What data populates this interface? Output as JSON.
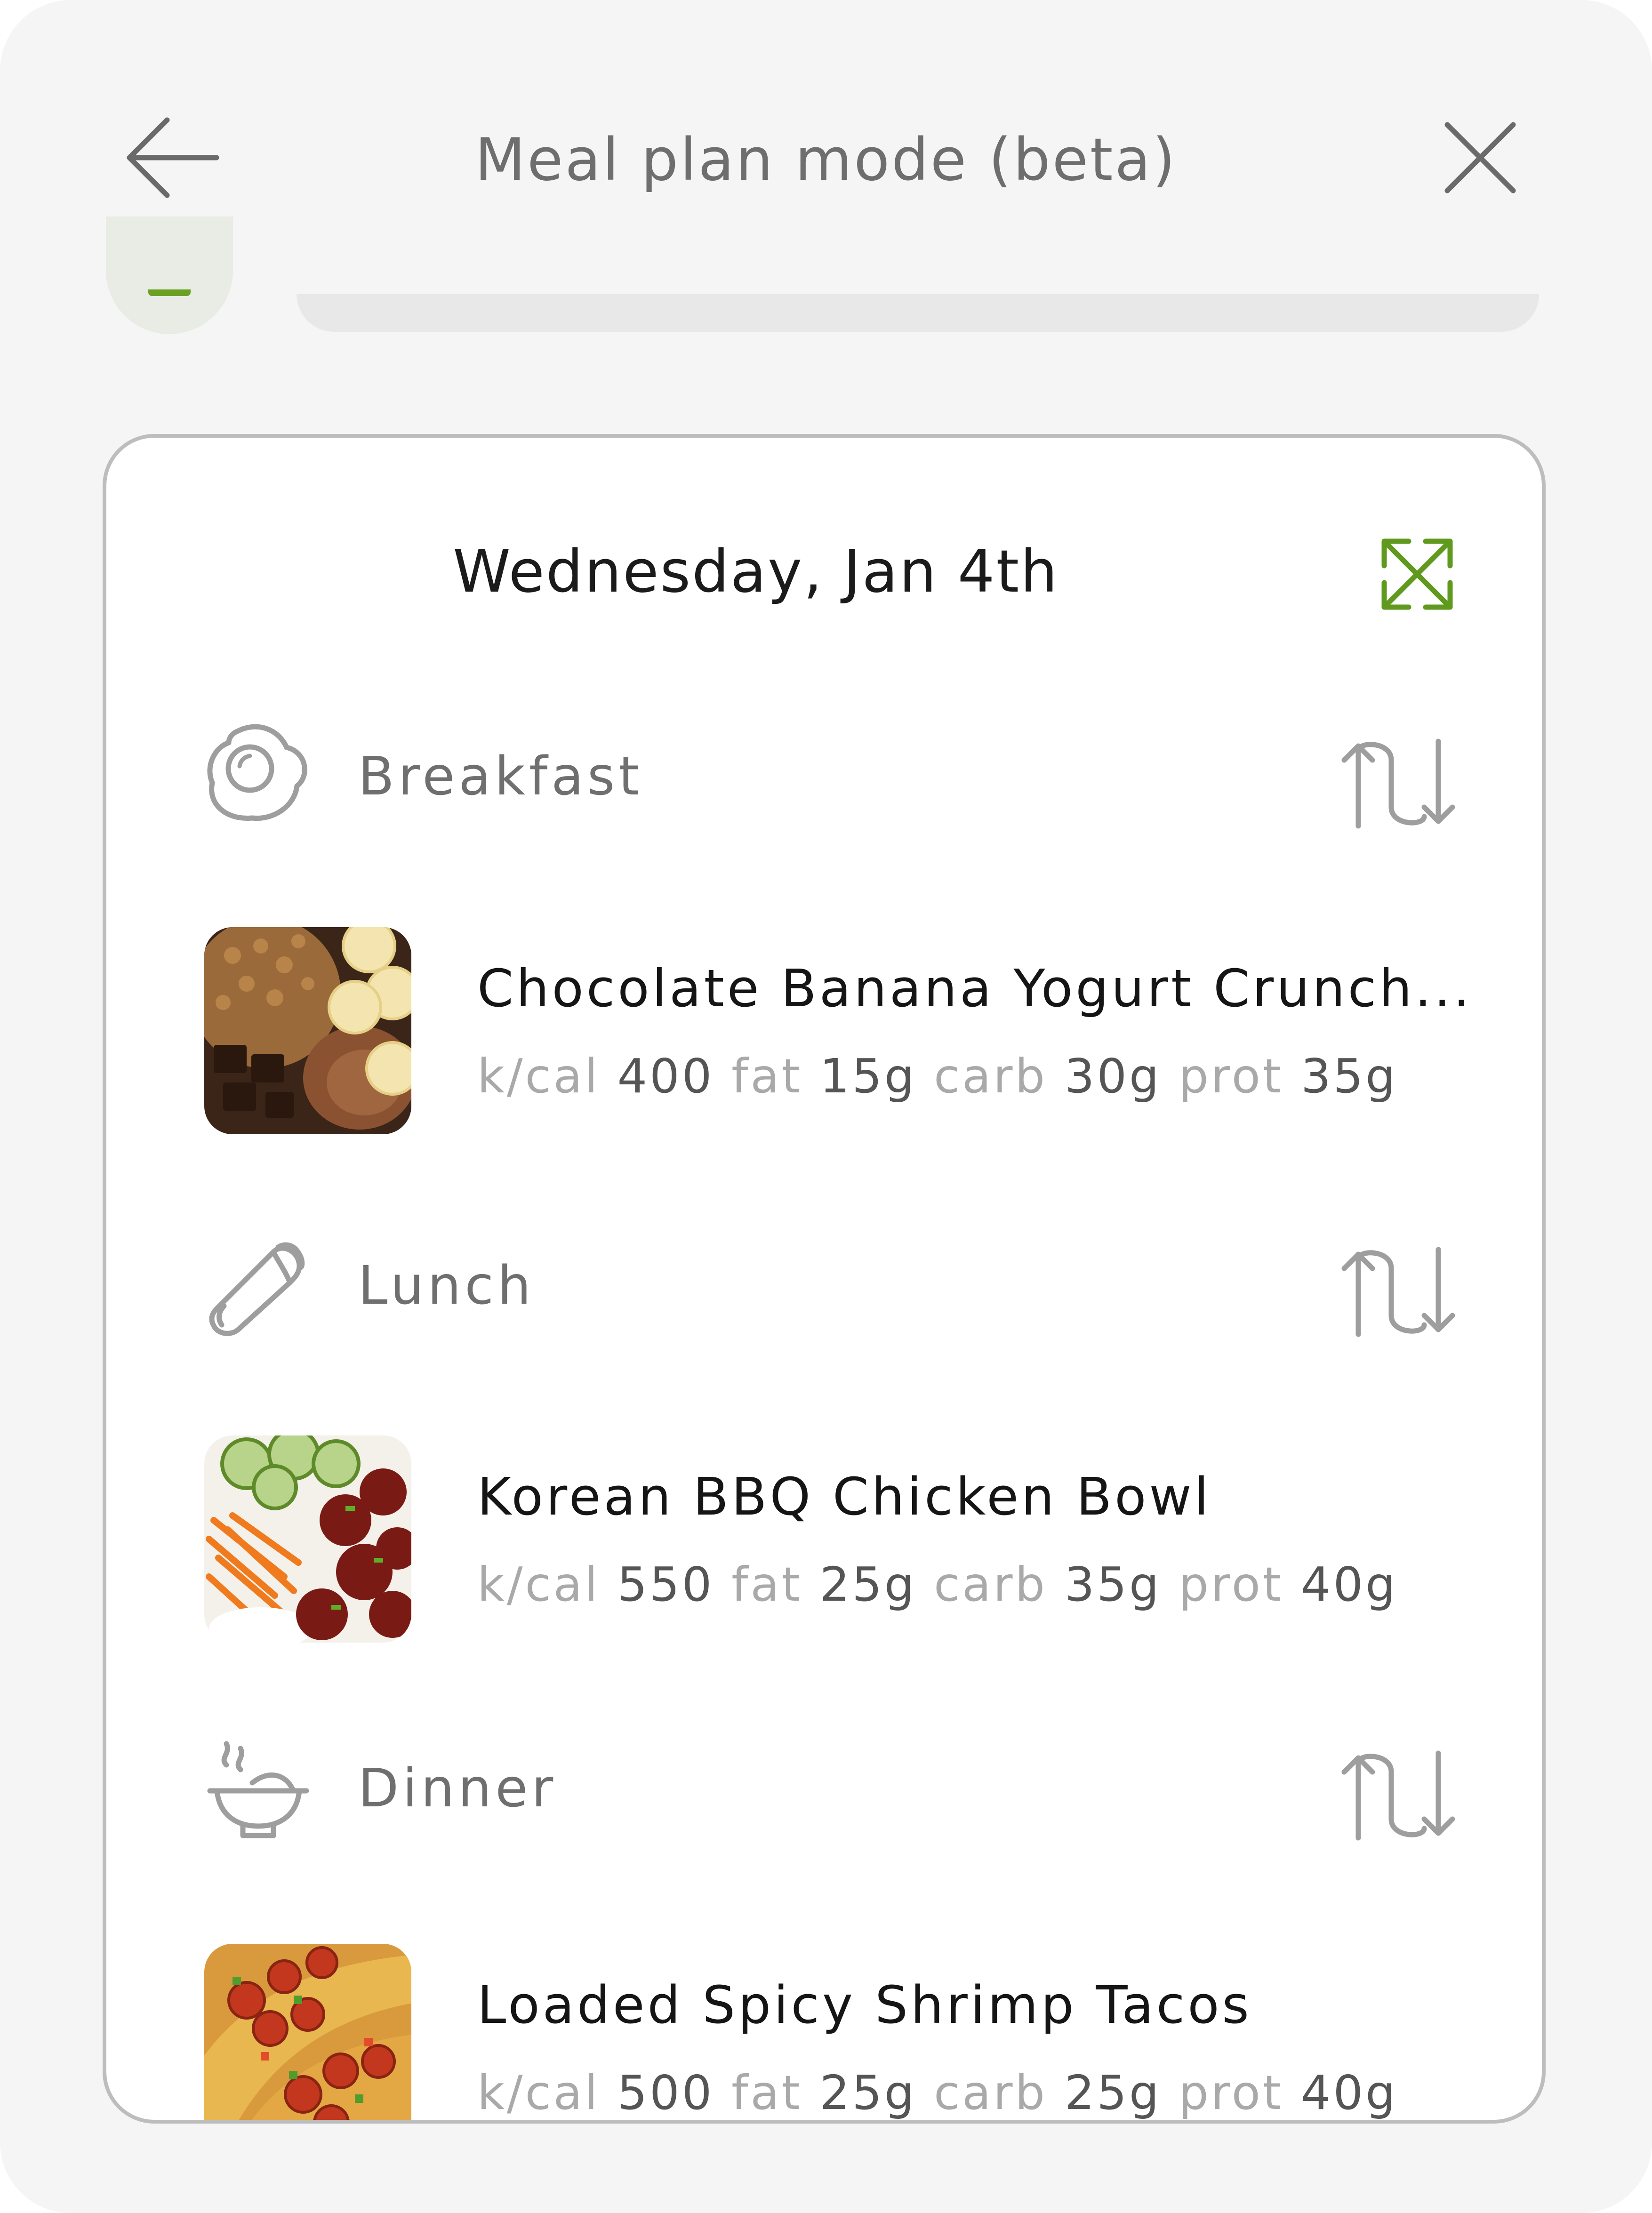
{
  "header": {
    "title": "Meal plan mode (beta)"
  },
  "card": {
    "date": "Wednesday, Jan 4th",
    "meals": [
      {
        "label": "Breakfast",
        "icon": "fried-egg-icon",
        "recipe": {
          "title": "Chocolate Banana Yogurt Crunch...",
          "macro_labels": {
            "kcal": "k/cal",
            "fat": "fat",
            "carb": "carb",
            "prot": "prot"
          },
          "kcal": "400",
          "fat": "15g",
          "carb": "30g",
          "prot": "35g"
        }
      },
      {
        "label": "Lunch",
        "icon": "burrito-icon",
        "recipe": {
          "title": "Korean BBQ Chicken Bowl",
          "macro_labels": {
            "kcal": "k/cal",
            "fat": "fat",
            "carb": "carb",
            "prot": "prot"
          },
          "kcal": "550",
          "fat": "25g",
          "carb": "35g",
          "prot": "40g"
        }
      },
      {
        "label": "Dinner",
        "icon": "steaming-bowl-icon",
        "recipe": {
          "title": "Loaded Spicy Shrimp Tacos",
          "macro_labels": {
            "kcal": "k/cal",
            "fat": "fat",
            "carb": "carb",
            "prot": "prot"
          },
          "kcal": "500",
          "fat": "25g",
          "carb": "25g",
          "prot": "40g"
        }
      }
    ]
  },
  "colors": {
    "accent_green": "#5f9a1e",
    "icon_gray": "#9e9e9e",
    "text_dark": "#1b1b1b",
    "text_muted": "#a9a9a9",
    "screen_bg": "#f5f5f5",
    "card_border": "#bdbdbd"
  }
}
